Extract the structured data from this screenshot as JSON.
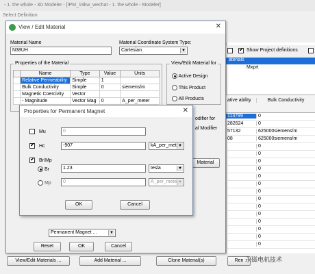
{
  "app": {
    "title": "- 1. the whole - 3D Modeler - [IPM_18kw_wechat - 1. the whole - Modeler]",
    "subtitle": "Select Definition"
  },
  "background": {
    "show_project_label": "Show Project definitions",
    "selected_tree_item": "aterials",
    "tree_item": "Mxprt",
    "grid_headers": [
      "ative ability",
      "Bulk Conductivity"
    ],
    "grid_rows": [
      [
        "113799",
        "0"
      ],
      [
        "282624",
        "0"
      ],
      [
        "57132",
        "625000siemens/m"
      ],
      [
        "08",
        "625000siemens/m"
      ],
      [
        "",
        "0"
      ],
      [
        "",
        "0"
      ],
      [
        "",
        "0"
      ],
      [
        "",
        "0"
      ],
      [
        "",
        "0"
      ],
      [
        "",
        "0"
      ],
      [
        "",
        "0"
      ],
      [
        "",
        "0"
      ],
      [
        "",
        "0"
      ],
      [
        "",
        "0"
      ],
      [
        "",
        "0"
      ],
      [
        "",
        "0"
      ],
      [
        "",
        "0"
      ],
      [
        "",
        "0"
      ]
    ],
    "buttons": [
      "View/Edit Materials ...",
      "Add Material ...",
      "Clone Material(s)",
      "Ren"
    ],
    "watermark": "永磁电机技术"
  },
  "dialog1": {
    "title": "View / Edit Material",
    "material_name_label": "Material Name",
    "material_name": "N38UH",
    "coord_label": "Material Coordinate System Type:",
    "coord_value": "Cartesian",
    "props_group": "Properties of the Material",
    "table_headers": [
      "Name",
      "Type",
      "Value",
      "Units"
    ],
    "table_rows": [
      [
        "Relative Permeability",
        "Simple",
        "1",
        ""
      ],
      [
        "Bulk Conductivity",
        "Simple",
        "0",
        "siemens/m"
      ],
      [
        "Magnetic Coercivity",
        "Vector",
        "",
        ""
      ],
      [
        "- Magnitude",
        "Vector Mag",
        "0",
        "A_per_meter"
      ]
    ],
    "view_group": "View/Edit Material for",
    "radio_active": "Active Design",
    "radio_product": "This Product",
    "radio_all": "All Products",
    "modifier_text": "odifier for",
    "modifier_btn": "al Modifier",
    "material_btn": "Material",
    "magnet_combo": "Permanent Magnet ...",
    "reset": "Reset",
    "ok": "OK",
    "cancel": "Cancel"
  },
  "dialog2": {
    "title": "Properties for Permanent Magnet",
    "mu_label": "Mu",
    "mu_value": "0",
    "hc_label": "Hc",
    "hc_value": "-907",
    "hc_unit": "kA_per_meter",
    "brmp_label": "Br/Mp",
    "br_label": "Br",
    "br_value": "1.23",
    "br_unit": "tesla",
    "mp_label": "Mp",
    "mp_value": "0",
    "mp_unit": "A_per_meter",
    "ok": "OK",
    "cancel": "Cancel"
  }
}
